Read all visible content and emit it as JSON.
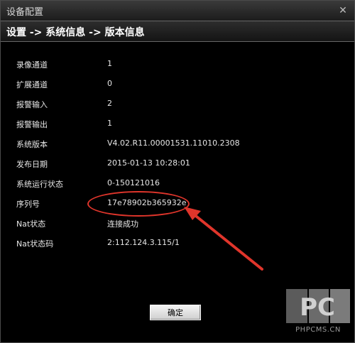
{
  "window": {
    "title": "设备配置",
    "close_glyph": "✕"
  },
  "breadcrumb": "设置 -> 系统信息 -> 版本信息",
  "info_rows": [
    {
      "label": "录像通道",
      "value": "1"
    },
    {
      "label": "扩展通道",
      "value": "0"
    },
    {
      "label": "报警输入",
      "value": "2"
    },
    {
      "label": "报警输出",
      "value": "1"
    },
    {
      "label": "系统版本",
      "value": "V4.02.R11.00001531.11010.2308"
    },
    {
      "label": "发布日期",
      "value": "2015-01-13 10:28:01"
    },
    {
      "label": "系统运行状态",
      "value": "0-150121016"
    },
    {
      "label": "序列号",
      "value": "17e78902b365932e"
    },
    {
      "label": "Nat状态",
      "value": "连接成功"
    },
    {
      "label": "Nat状态码",
      "value": "2:112.124.3.115/1"
    }
  ],
  "buttons": {
    "ok_label": "确定"
  },
  "watermark": {
    "text": "PHPCMS.CN",
    "logo_text": "PC"
  },
  "colors": {
    "annotation_red": "#e0352b",
    "background": "#000000"
  }
}
